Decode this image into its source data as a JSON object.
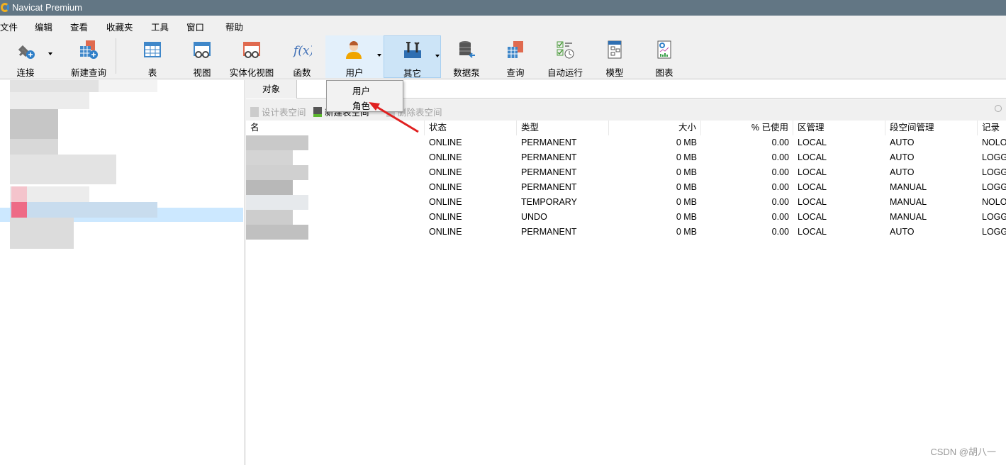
{
  "window": {
    "title": "Navicat Premium"
  },
  "menu": [
    "文件",
    "编辑",
    "查看",
    "收藏夹",
    "工具",
    "窗口",
    "帮助"
  ],
  "toolbar": {
    "items": [
      {
        "label": "连接",
        "icon": "plug-icon"
      },
      {
        "label": "新建查询",
        "icon": "new-query-icon"
      },
      {
        "label": "表",
        "icon": "table-icon"
      },
      {
        "label": "视图",
        "icon": "view-icon"
      },
      {
        "label": "实体化视图",
        "icon": "materialized-view-icon"
      },
      {
        "label": "函数",
        "icon": "function-icon"
      },
      {
        "label": "用户",
        "icon": "user-icon"
      },
      {
        "label": "其它",
        "icon": "tools-icon"
      },
      {
        "label": "数据泵",
        "icon": "data-pump-icon"
      },
      {
        "label": "查询",
        "icon": "query-icon"
      },
      {
        "label": "自动运行",
        "icon": "automation-icon"
      },
      {
        "label": "模型",
        "icon": "model-icon"
      },
      {
        "label": "图表",
        "icon": "chart-icon"
      }
    ]
  },
  "dropdown": {
    "items": [
      "用户",
      "角色"
    ]
  },
  "tabs": {
    "objects": "对象"
  },
  "subtoolbar": {
    "design": "设计表空间",
    "new": "新建表空间",
    "delete": "删除表空间"
  },
  "table": {
    "columns": [
      "名",
      "状态",
      "类型",
      "大小",
      "% 已使用",
      "区管理",
      "段空间管理",
      "记录"
    ],
    "rows": [
      [
        "",
        "ONLINE",
        "PERMANENT",
        "0 MB",
        "0.00",
        "LOCAL",
        "AUTO",
        "NOLO"
      ],
      [
        "",
        "ONLINE",
        "PERMANENT",
        "0 MB",
        "0.00",
        "LOCAL",
        "AUTO",
        "LOGG"
      ],
      [
        "",
        "ONLINE",
        "PERMANENT",
        "0 MB",
        "0.00",
        "LOCAL",
        "AUTO",
        "LOGG"
      ],
      [
        "",
        "ONLINE",
        "PERMANENT",
        "0 MB",
        "0.00",
        "LOCAL",
        "MANUAL",
        "LOGG"
      ],
      [
        "",
        "ONLINE",
        "TEMPORARY",
        "0 MB",
        "0.00",
        "LOCAL",
        "MANUAL",
        "NOLO"
      ],
      [
        "",
        "ONLINE",
        "UNDO",
        "0 MB",
        "0.00",
        "LOCAL",
        "MANUAL",
        "LOGG"
      ],
      [
        "",
        "ONLINE",
        "PERMANENT",
        "0 MB",
        "0.00",
        "LOCAL",
        "AUTO",
        "LOGG"
      ]
    ]
  },
  "watermark": "CSDN @胡八一",
  "colors": {
    "titlebar": "#627684",
    "selection": "#cce8ff",
    "annotation_arrow": "#e02020"
  }
}
